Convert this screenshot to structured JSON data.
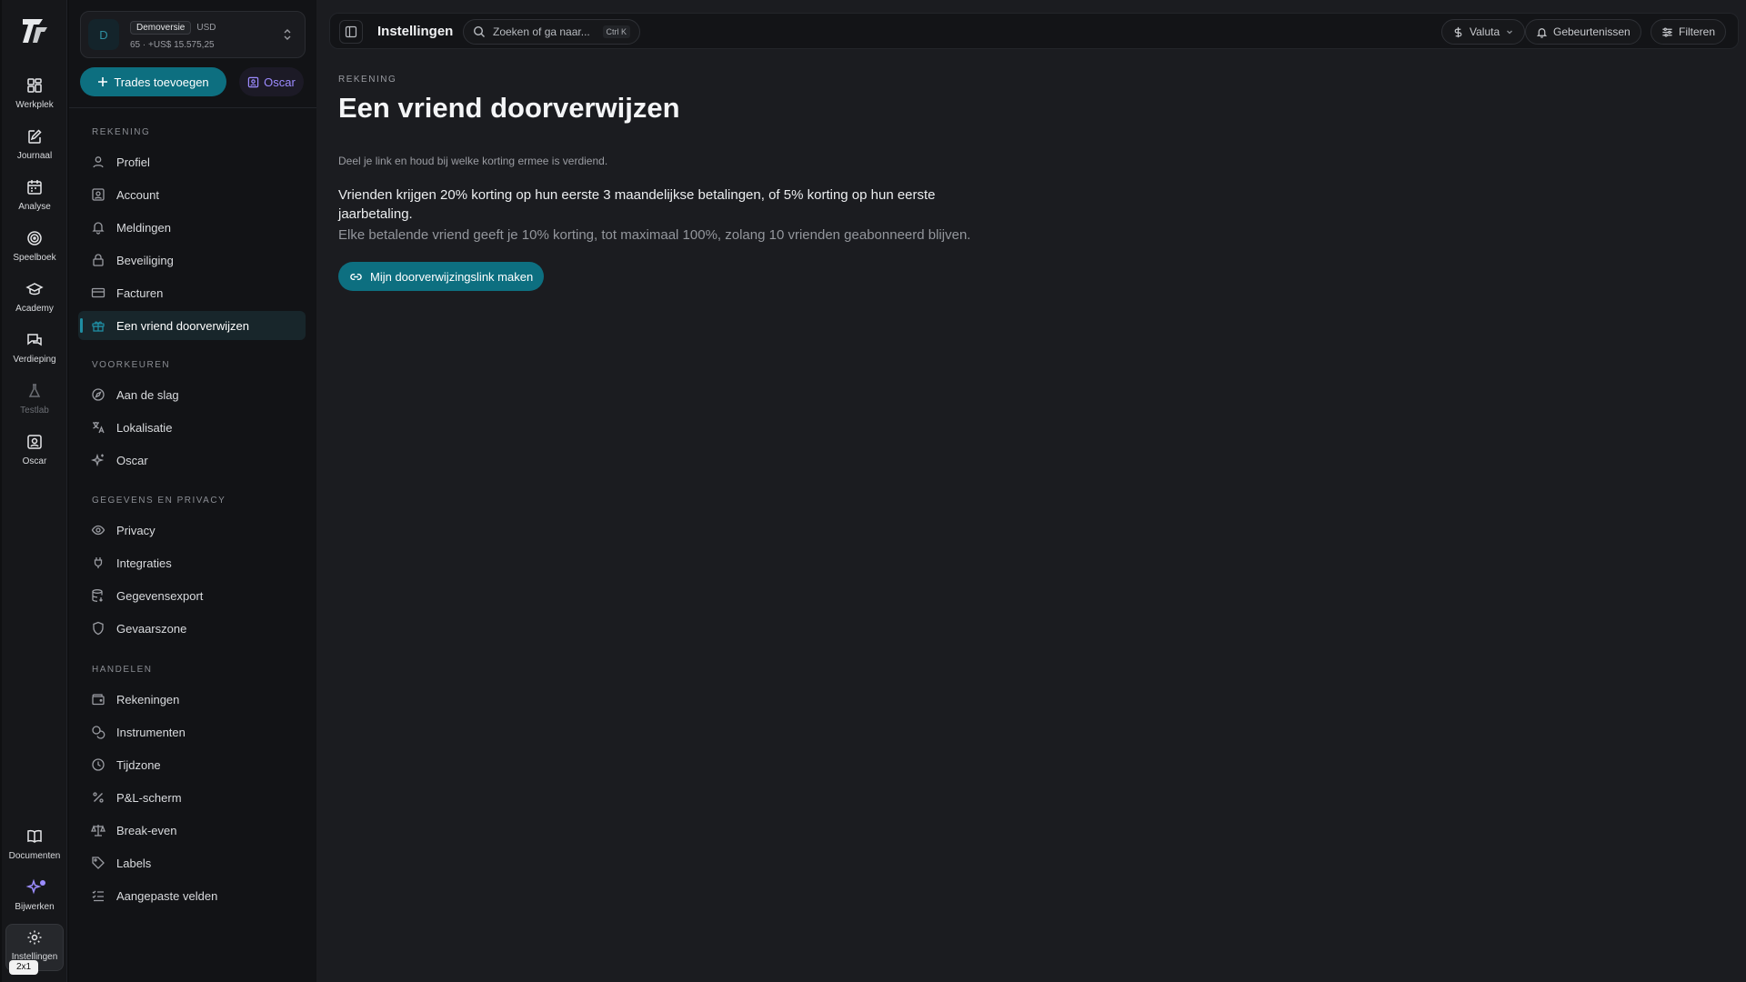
{
  "rail": {
    "items": [
      {
        "label": "Werkplek"
      },
      {
        "label": "Journaal"
      },
      {
        "label": "Analyse"
      },
      {
        "label": "Speelboek"
      },
      {
        "label": "Academy"
      },
      {
        "label": "Verdieping"
      },
      {
        "label": "Testlab"
      },
      {
        "label": "Oscar"
      }
    ],
    "bottom": [
      {
        "label": "Documenten"
      },
      {
        "label": "Bijwerken"
      },
      {
        "label": "Instellingen"
      }
    ],
    "scale_badge": "2x1"
  },
  "account": {
    "avatar": "D",
    "badge": "Demoversie",
    "currency": "USD",
    "summary": "65 · +US$ 15.575,25"
  },
  "actions": {
    "add_trades": "Trades toevoegen",
    "oscar": "Oscar"
  },
  "nav": {
    "sections": [
      {
        "title": "REKENING",
        "items": [
          "Profiel",
          "Account",
          "Meldingen",
          "Beveiliging",
          "Facturen",
          "Een vriend doorverwijzen"
        ]
      },
      {
        "title": "VOORKEUREN",
        "items": [
          "Aan de slag",
          "Lokalisatie",
          "Oscar"
        ]
      },
      {
        "title": "GEGEVENS EN PRIVACY",
        "items": [
          "Privacy",
          "Integraties",
          "Gegevensexport",
          "Gevaarszone"
        ]
      },
      {
        "title": "HANDELEN",
        "items": [
          "Rekeningen",
          "Instrumenten",
          "Tijdzone",
          "P&L-scherm",
          "Break-even",
          "Labels",
          "Aangepaste velden"
        ]
      }
    ],
    "active": "Een vriend doorverwijzen"
  },
  "topbar": {
    "title": "Instellingen",
    "search_placeholder": "Zoeken of ga naar...",
    "shortcut": "Ctrl K",
    "currency_btn": "Valuta",
    "events_btn": "Gebeurtenissen",
    "filter_btn": "Filteren"
  },
  "content": {
    "overline": "REKENING",
    "title": "Een vriend doorverwijzen",
    "subtitle": "Deel je link en houd bij welke korting ermee is verdiend.",
    "para1": "Vrienden krijgen 20% korting op hun eerste 3 maandelijkse betalingen, of 5% korting op hun eerste jaarbetaling.",
    "para2": "Elke betalende vriend geeft je 10% korting, tot maximaal 100%, zolang 10 vrienden geabonneerd blijven.",
    "cta": "Mijn doorverwijzingslink maken"
  },
  "colors": {
    "accent": "#0d6f80",
    "oscar": "#9c8bff",
    "background": "#1b1c20"
  }
}
